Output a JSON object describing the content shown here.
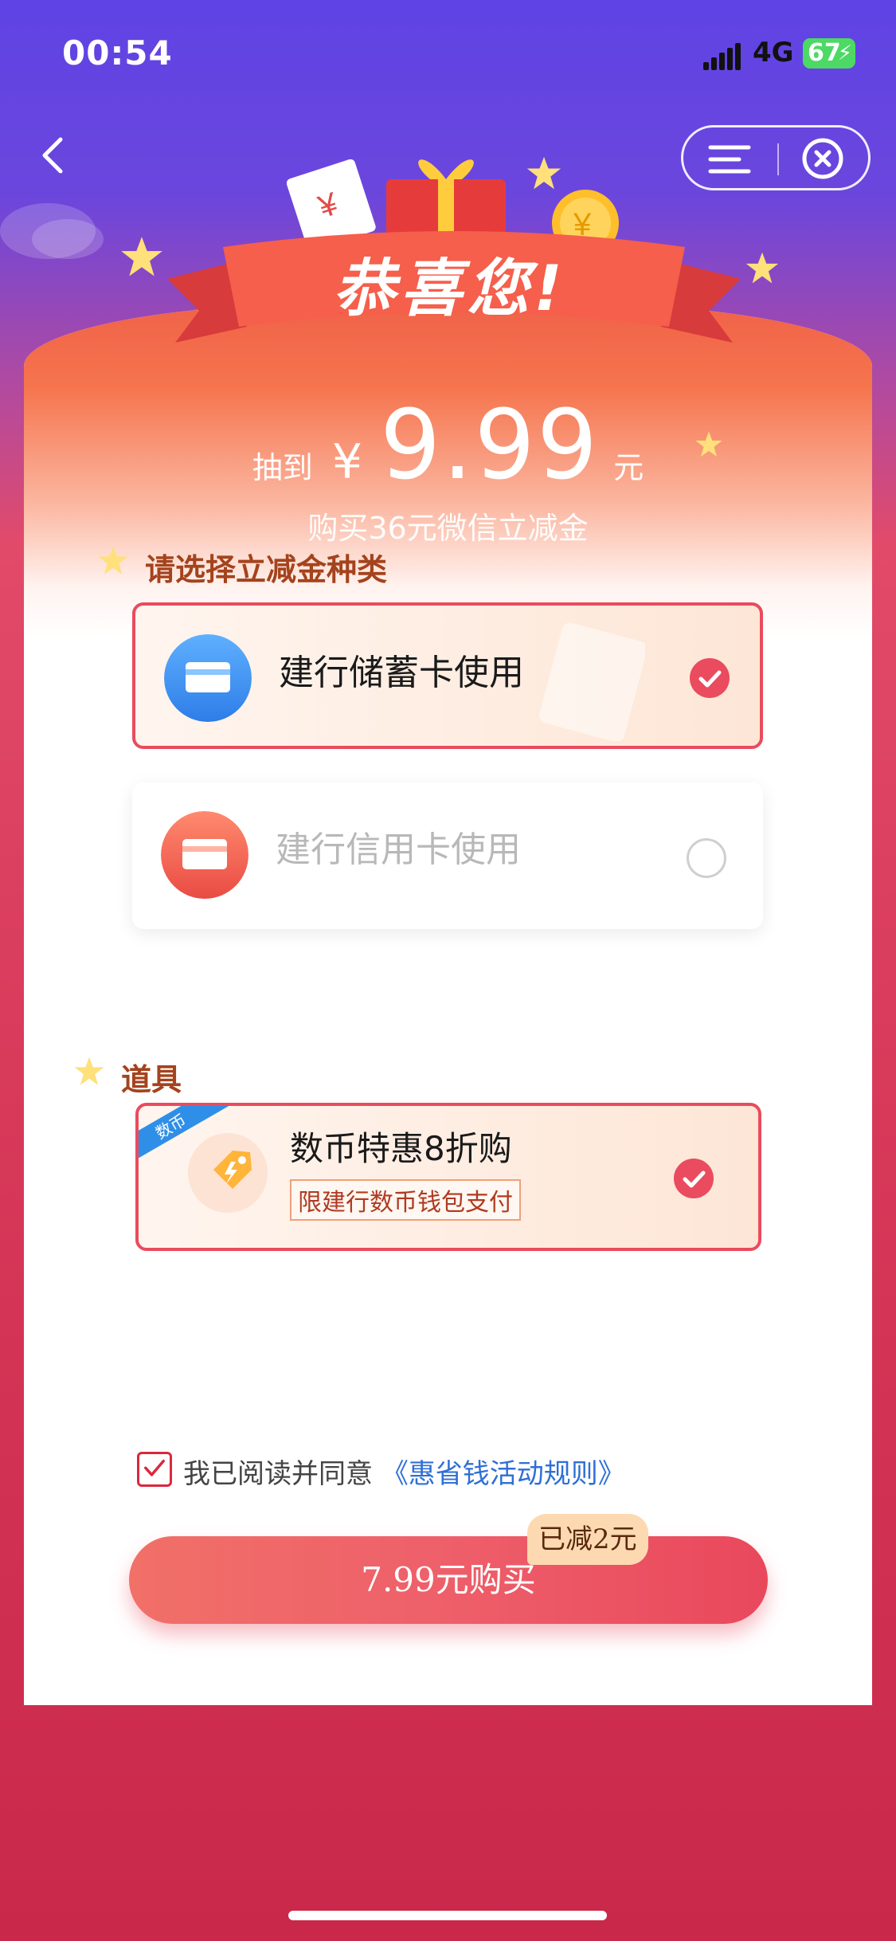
{
  "status_bar": {
    "time": "00:54",
    "network": "4G",
    "battery": "67"
  },
  "nav": {
    "back_icon": "chevron-left-icon",
    "menu_icon": "menu-icon",
    "close_icon": "close-circle-icon"
  },
  "banner": {
    "title": "恭喜您!"
  },
  "prize": {
    "prefix": "抽到",
    "currency": "¥",
    "amount": "9.99",
    "unit": "元",
    "subtitle": "购买36元微信立减金"
  },
  "choose_section": {
    "title": "请选择立减金种类",
    "options": [
      {
        "label": "建行储蓄卡使用",
        "selected": true,
        "icon": "debit-card-icon"
      },
      {
        "label": "建行信用卡使用",
        "selected": false,
        "icon": "credit-card-icon"
      }
    ]
  },
  "props_section": {
    "title": "道具",
    "item": {
      "tag": "数币",
      "title": "数币特惠8折购",
      "limit": "限建行数币钱包支付",
      "selected": true,
      "icon": "tag-icon"
    }
  },
  "agreement": {
    "text": "我已阅读并同意",
    "link": "《惠省钱活动规则》",
    "checked": true
  },
  "buy": {
    "label": "7.99元购买",
    "badge": "已减2元"
  },
  "colors": {
    "accent": "#ea4b5e",
    "brand_purple": "#5f43e4",
    "section_title": "#a4431d",
    "link": "#2f6fd6"
  }
}
